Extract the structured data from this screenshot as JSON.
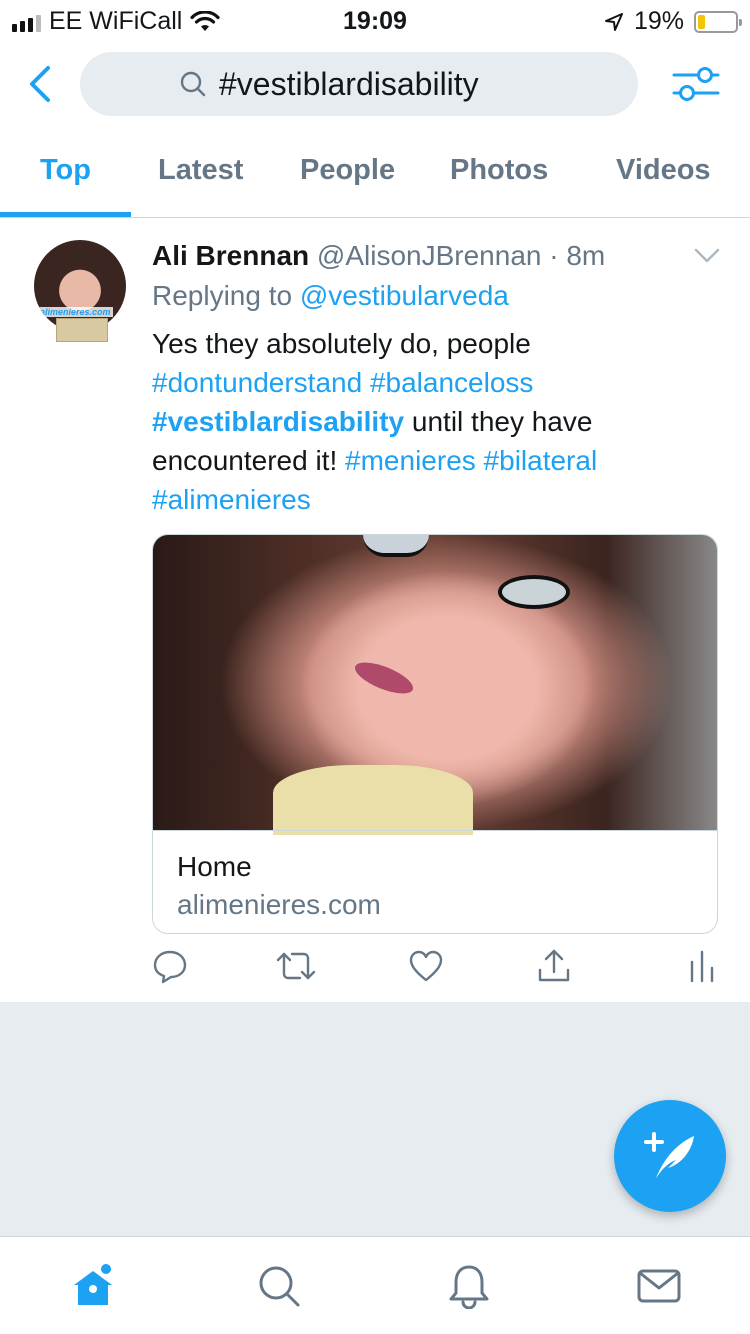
{
  "status_bar": {
    "carrier": "EE WiFiCall",
    "time": "19:09",
    "battery": "19%",
    "battery_level": 0.19
  },
  "search": {
    "query": "#vestiblardisability"
  },
  "tabs": [
    {
      "label": "Top",
      "active": true
    },
    {
      "label": "Latest",
      "active": false
    },
    {
      "label": "People",
      "active": false
    },
    {
      "label": "Photos",
      "active": false
    },
    {
      "label": "Videos",
      "active": false
    }
  ],
  "tweet": {
    "avatar_watermark": "alimenieres.com",
    "name": "Ali Brennan",
    "handle": "@AlisonJBrennan",
    "separator": "·",
    "time": "8m",
    "replying_prefix": "Replying to",
    "replying_to": "@vestibularveda",
    "text": {
      "t1": "Yes they absolutely do, people",
      "h1": "#dontunderstand",
      "h2": "#balanceloss",
      "h3": "#vestiblardisability",
      "t2": "until they have encountered it!",
      "h4": "#menieres",
      "h5": "#bilateral",
      "h6": "#alimenieres"
    },
    "card": {
      "title": "Home",
      "domain": "alimenieres.com"
    }
  },
  "icons": {
    "back": "chevron-left-icon",
    "filter": "sliders-icon",
    "compose": "feather-plus-icon",
    "nav": [
      "home-icon",
      "search-icon",
      "bell-icon",
      "mail-icon"
    ]
  },
  "colors": {
    "accent": "#1da1f2",
    "secondary_text": "#657786",
    "background_gray": "#e6ecf0"
  }
}
